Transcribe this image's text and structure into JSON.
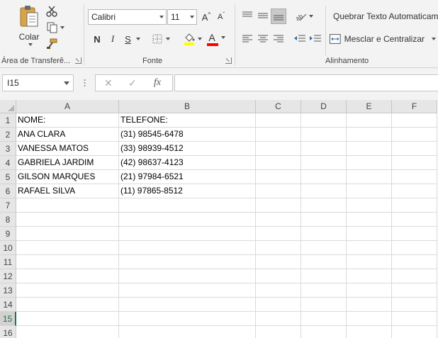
{
  "ribbon": {
    "clipboard": {
      "paste_label": "Colar",
      "group_label": "Área de Transferê..."
    },
    "font": {
      "font_name": "Calibri",
      "font_size": "11",
      "grow_label": "A",
      "shrink_label": "A",
      "bold_label": "N",
      "italic_label": "I",
      "underline_label": "S",
      "font_color_label": "A",
      "group_label": "Fonte",
      "highlight_color": "#ffff00",
      "font_color": "#ff0000"
    },
    "alignment": {
      "wrap_text_label": "Quebrar Texto Automaticamente",
      "merge_center_label": "Mesclar e Centralizar",
      "group_label": "Alinhamento"
    }
  },
  "formula_bar": {
    "name_box": "I15",
    "cancel_symbol": "✕",
    "enter_symbol": "✓",
    "fx_symbol": "fx",
    "formula": ""
  },
  "sheet": {
    "columns": [
      "A",
      "B",
      "C",
      "D",
      "E",
      "F"
    ],
    "rows": [
      "1",
      "2",
      "3",
      "4",
      "5",
      "6",
      "7",
      "8",
      "9",
      "10",
      "11",
      "12",
      "13",
      "14",
      "15",
      "16"
    ],
    "active_row": "15",
    "cells": [
      [
        "NOME:",
        "TELEFONE:"
      ],
      [
        "ANA CLARA",
        "(31) 98545-6478"
      ],
      [
        "VANESSA MATOS",
        "(33) 98939-4512"
      ],
      [
        "GABRIELA JARDIM",
        "(42) 98637-4123"
      ],
      [
        "GILSON MARQUES",
        "(21) 97984-6521"
      ],
      [
        "RAFAEL SILVA",
        "(11) 97865-8512"
      ]
    ]
  },
  "colors": {
    "accent": "#217346",
    "ribbon_bg": "#f3f3f3",
    "header_bg": "#e6e6e6"
  }
}
